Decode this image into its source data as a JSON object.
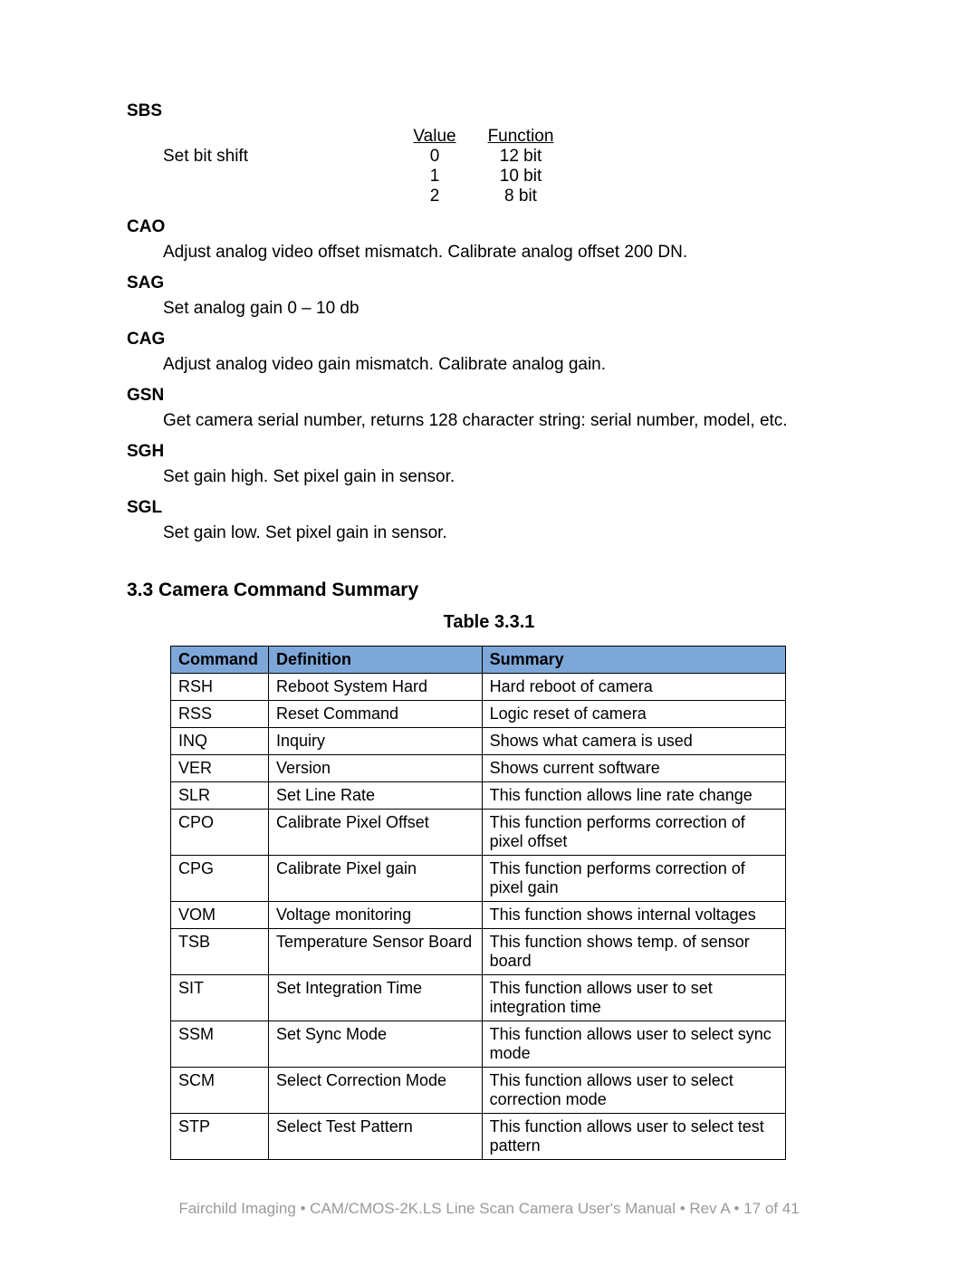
{
  "sbs": {
    "heading": "SBS",
    "label": "Set  bit shift",
    "header_value": "Value",
    "header_function": "Function",
    "rows": [
      {
        "value": "0",
        "function": "12 bit"
      },
      {
        "value": "1",
        "function": "10 bit"
      },
      {
        "value": "2",
        "function": "8 bit"
      }
    ]
  },
  "defs": [
    {
      "heading": "CAO",
      "desc": "Adjust analog video offset mismatch.  Calibrate analog offset  200 DN."
    },
    {
      "heading": "SAG",
      "desc": "Set analog gain   0 – 10 db"
    },
    {
      "heading": "CAG",
      "desc": "Adjust analog video gain mismatch.  Calibrate analog gain."
    },
    {
      "heading": "GSN",
      "desc": "Get camera serial number, returns 128 character string:  serial number, model, etc."
    },
    {
      "heading": "SGH",
      "desc": "Set gain high.  Set pixel gain in sensor."
    },
    {
      "heading": "SGL",
      "desc": "Set gain low.  Set pixel gain in sensor."
    }
  ],
  "section_heading": "3.3  Camera Command Summary",
  "table_caption": "Table 3.3.1",
  "table_headers": {
    "command": "Command",
    "definition": "Definition",
    "summary": "Summary"
  },
  "table_rows": [
    {
      "command": "RSH",
      "definition": "Reboot System Hard",
      "summary": "Hard reboot of camera"
    },
    {
      "command": "RSS",
      "definition": "Reset Command",
      "summary": "Logic reset of camera"
    },
    {
      "command": "INQ",
      "definition": "Inquiry",
      "summary": "Shows what camera is used"
    },
    {
      "command": "VER",
      "definition": "Version",
      "summary": "Shows current software"
    },
    {
      "command": "SLR",
      "definition": "Set Line Rate",
      "summary": "This function allows line rate change"
    },
    {
      "command": "CPO",
      "definition": "Calibrate Pixel Offset",
      "summary": "This function performs correction of pixel offset"
    },
    {
      "command": "CPG",
      "definition": "Calibrate Pixel gain",
      "summary": "This function performs correction of pixel gain"
    },
    {
      "command": "VOM",
      "definition": "Voltage monitoring",
      "summary": "This function shows internal voltages"
    },
    {
      "command": "TSB",
      "definition": "Temperature Sensor Board",
      "summary": "This function shows temp. of sensor board"
    },
    {
      "command": "SIT",
      "definition": "Set Integration Time",
      "summary": "This function allows user to set integration time"
    },
    {
      "command": "SSM",
      "definition": "Set Sync Mode",
      "summary": "This function allows user to select sync mode"
    },
    {
      "command": "SCM",
      "definition": "Select Correction Mode",
      "summary": "This function allows user to select correction mode"
    },
    {
      "command": "STP",
      "definition": "Select Test Pattern",
      "summary": "This function allows user to select test pattern"
    }
  ],
  "footer": "Fairchild Imaging • CAM/CMOS-2K.LS Line Scan Camera User's Manual • Rev A • 17 of 41"
}
